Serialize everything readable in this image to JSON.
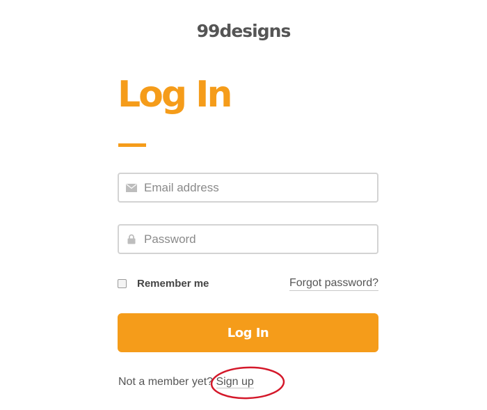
{
  "header": {
    "logo_text": "99designs"
  },
  "form": {
    "title": "Log In",
    "email": {
      "placeholder": "Email address",
      "value": "",
      "icon": "envelope-icon"
    },
    "password": {
      "placeholder": "Password",
      "value": "",
      "icon": "lock-icon"
    },
    "remember_label": "Remember me",
    "remember_checked": false,
    "forgot_label": "Forgot password?",
    "submit_label": "Log In"
  },
  "footer": {
    "prompt": "Not a member yet?",
    "signup_label": "Sign up"
  },
  "colors": {
    "accent": "#f59c1a",
    "annotation": "#d4182a"
  }
}
